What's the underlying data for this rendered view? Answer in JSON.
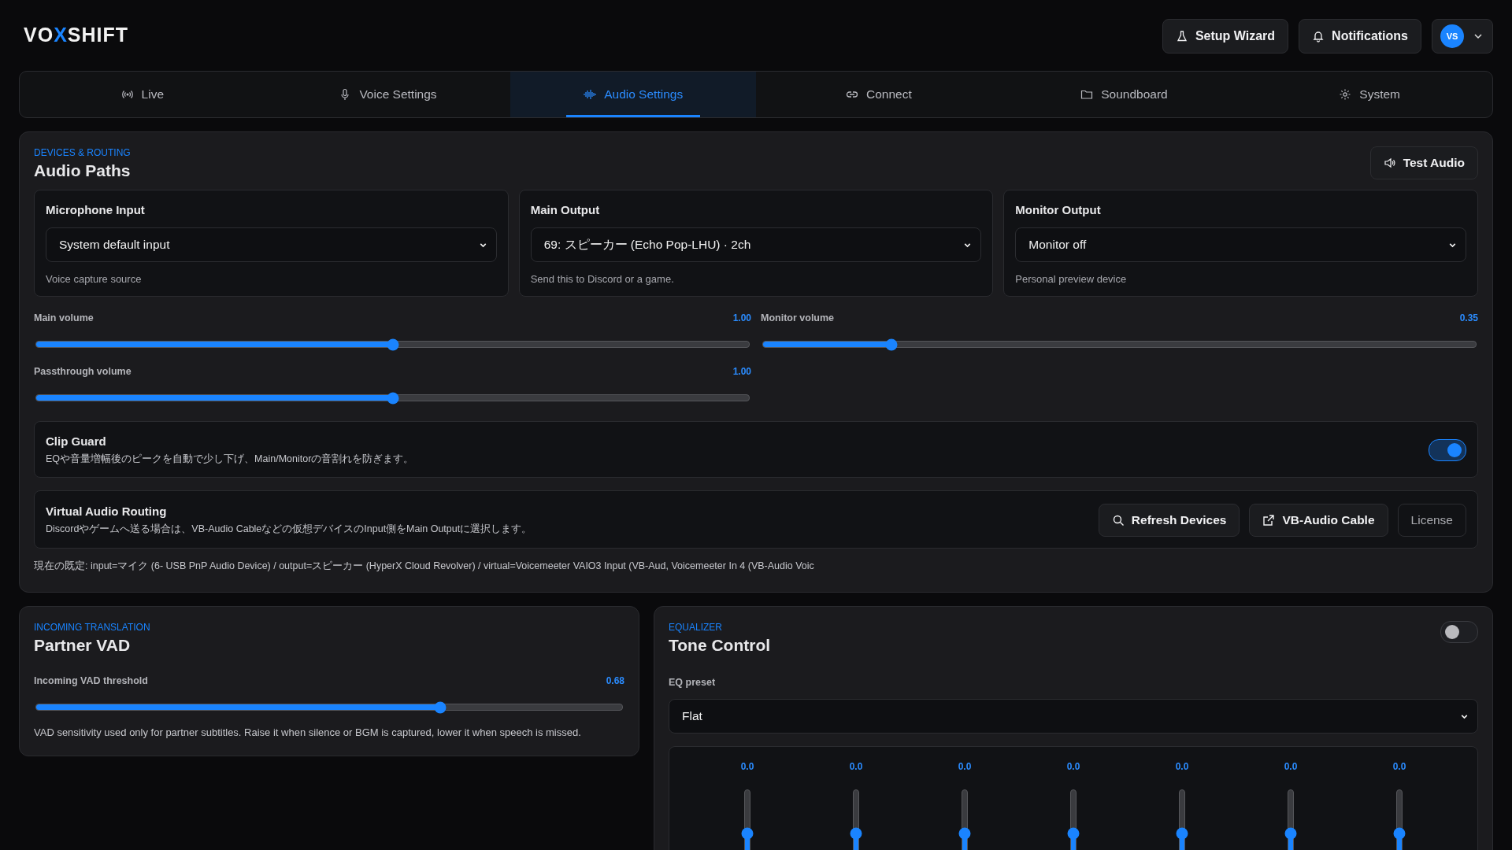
{
  "header": {
    "logo": {
      "left": "VO",
      "mark": "X",
      "right": "SHIFT"
    },
    "buttons": [
      {
        "label": "Setup Wizard",
        "kind": "wizard"
      },
      {
        "label": "Notifications",
        "kind": "bell"
      }
    ],
    "avatar": "VS"
  },
  "tabs": [
    {
      "label": "Live",
      "kind": "live",
      "selected": false
    },
    {
      "label": "Voice Settings",
      "kind": "mic",
      "selected": false
    },
    {
      "label": "Audio Settings",
      "kind": "wave",
      "selected": true
    },
    {
      "label": "Connect",
      "kind": "link",
      "selected": false
    },
    {
      "label": "Soundboard",
      "kind": "folder",
      "selected": false
    },
    {
      "label": "System",
      "kind": "gear",
      "selected": false
    }
  ],
  "audio_paths": {
    "eyebrow": "DEVICES & ROUTING",
    "title": "Audio Paths",
    "test_button": "Test Audio",
    "devices": [
      {
        "label": "Microphone Input",
        "value": "System default input",
        "hint": "Voice capture source"
      },
      {
        "label": "Main Output",
        "value": "69: スピーカー (Echo Pop-LHU) · 2ch",
        "hint": "Send this to Discord or a game."
      },
      {
        "label": "Monitor Output",
        "value": "Monitor off",
        "hint": "Personal preview device"
      }
    ],
    "sliders": [
      {
        "label": "Main volume",
        "reading": "1.00",
        "level": 0.5
      },
      {
        "label": "Monitor volume",
        "reading": "0.35",
        "level": 0.18
      },
      {
        "label": "Passthrough volume",
        "reading": "1.00",
        "level": 0.5
      }
    ],
    "clip_guard": {
      "title": "Clip Guard",
      "description": "EQや音量増幅後のピークを自動で少し下げ、Main/Monitorの音割れを防ぎます。",
      "on": true
    },
    "routing": {
      "title": "Virtual Audio Routing",
      "description": "Discordやゲームへ送る場合は、VB-Audio Cableなどの仮想デバイスのInput側をMain Outputに選択します。",
      "buttons": [
        {
          "label": "Refresh Devices",
          "kind": "search"
        },
        {
          "label": "VB-Audio Cable",
          "kind": "external"
        },
        {
          "label": "License",
          "kind": "plain"
        }
      ]
    },
    "current_defaults": "現在の既定: input=マイク (6- USB PnP Audio Device) / output=スピーカー (HyperX Cloud Revolver) / virtual=Voicemeeter VAIO3 Input (VB-Aud, Voicemeeter In 4 (VB-Audio Voic"
  },
  "partner_vad": {
    "eyebrow": "INCOMING TRANSLATION",
    "title": "Partner VAD",
    "slider": {
      "label": "Incoming VAD threshold",
      "reading": "0.68",
      "level": 0.69
    },
    "description": "VAD sensitivity used only for partner subtitles. Raise it when silence or BGM is captured, lower it when speech is missed."
  },
  "tone_control": {
    "eyebrow": "EQUALIZER",
    "title": "Tone Control",
    "on": false,
    "preset_label": "EQ preset",
    "preset": "Flat",
    "bands": [
      {
        "reading": "0.0",
        "level": 0.5
      },
      {
        "reading": "0.0",
        "level": 0.5
      },
      {
        "reading": "0.0",
        "level": 0.5
      },
      {
        "reading": "0.0",
        "level": 0.5
      },
      {
        "reading": "0.0",
        "level": 0.5
      },
      {
        "reading": "0.0",
        "level": 0.5
      },
      {
        "reading": "0.0",
        "level": 0.5
      }
    ]
  }
}
